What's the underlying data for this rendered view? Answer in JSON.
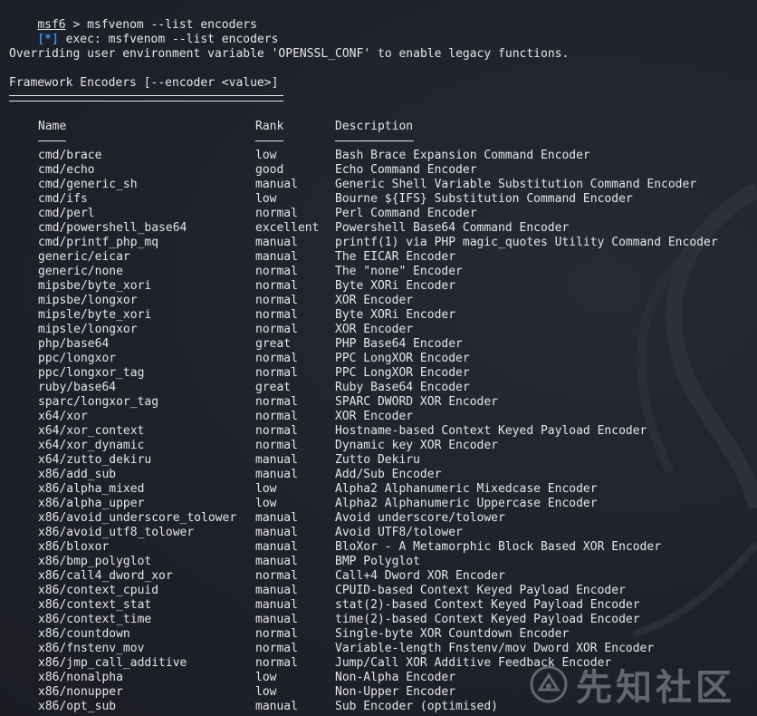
{
  "terminal": {
    "prompt": "msf6",
    "prompt_suffix": " > msfvenom --list encoders",
    "exec_tag": "[*]",
    "exec_text": " exec: msfvenom --list encoders",
    "warning": "Overriding user environment variable 'OPENSSL_CONF' to enable legacy functions.",
    "section_title": "Framework Encoders [--encoder <value>]",
    "columns": {
      "name": "Name",
      "rank": "Rank",
      "description": "Description"
    },
    "watermark_text": "先知社区"
  },
  "encoders": [
    {
      "name": "cmd/brace",
      "rank": "low",
      "description": "Bash Brace Expansion Command Encoder"
    },
    {
      "name": "cmd/echo",
      "rank": "good",
      "description": "Echo Command Encoder"
    },
    {
      "name": "cmd/generic_sh",
      "rank": "manual",
      "description": "Generic Shell Variable Substitution Command Encoder"
    },
    {
      "name": "cmd/ifs",
      "rank": "low",
      "description": "Bourne ${IFS} Substitution Command Encoder"
    },
    {
      "name": "cmd/perl",
      "rank": "normal",
      "description": "Perl Command Encoder"
    },
    {
      "name": "cmd/powershell_base64",
      "rank": "excellent",
      "description": "Powershell Base64 Command Encoder"
    },
    {
      "name": "cmd/printf_php_mq",
      "rank": "manual",
      "description": "printf(1) via PHP magic_quotes Utility Command Encoder"
    },
    {
      "name": "generic/eicar",
      "rank": "manual",
      "description": "The EICAR Encoder"
    },
    {
      "name": "generic/none",
      "rank": "normal",
      "description": "The \"none\" Encoder"
    },
    {
      "name": "mipsbe/byte_xori",
      "rank": "normal",
      "description": "Byte XORi Encoder"
    },
    {
      "name": "mipsbe/longxor",
      "rank": "normal",
      "description": "XOR Encoder"
    },
    {
      "name": "mipsle/byte_xori",
      "rank": "normal",
      "description": "Byte XORi Encoder"
    },
    {
      "name": "mipsle/longxor",
      "rank": "normal",
      "description": "XOR Encoder"
    },
    {
      "name": "php/base64",
      "rank": "great",
      "description": "PHP Base64 Encoder"
    },
    {
      "name": "ppc/longxor",
      "rank": "normal",
      "description": "PPC LongXOR Encoder"
    },
    {
      "name": "ppc/longxor_tag",
      "rank": "normal",
      "description": "PPC LongXOR Encoder"
    },
    {
      "name": "ruby/base64",
      "rank": "great",
      "description": "Ruby Base64 Encoder"
    },
    {
      "name": "sparc/longxor_tag",
      "rank": "normal",
      "description": "SPARC DWORD XOR Encoder"
    },
    {
      "name": "x64/xor",
      "rank": "normal",
      "description": "XOR Encoder"
    },
    {
      "name": "x64/xor_context",
      "rank": "normal",
      "description": "Hostname-based Context Keyed Payload Encoder"
    },
    {
      "name": "x64/xor_dynamic",
      "rank": "normal",
      "description": "Dynamic key XOR Encoder"
    },
    {
      "name": "x64/zutto_dekiru",
      "rank": "manual",
      "description": "Zutto Dekiru"
    },
    {
      "name": "x86/add_sub",
      "rank": "manual",
      "description": "Add/Sub Encoder"
    },
    {
      "name": "x86/alpha_mixed",
      "rank": "low",
      "description": "Alpha2 Alphanumeric Mixedcase Encoder"
    },
    {
      "name": "x86/alpha_upper",
      "rank": "low",
      "description": "Alpha2 Alphanumeric Uppercase Encoder"
    },
    {
      "name": "x86/avoid_underscore_tolower",
      "rank": "manual",
      "description": "Avoid underscore/tolower"
    },
    {
      "name": "x86/avoid_utf8_tolower",
      "rank": "manual",
      "description": "Avoid UTF8/tolower"
    },
    {
      "name": "x86/bloxor",
      "rank": "manual",
      "description": "BloXor - A Metamorphic Block Based XOR Encoder"
    },
    {
      "name": "x86/bmp_polyglot",
      "rank": "manual",
      "description": "BMP Polyglot"
    },
    {
      "name": "x86/call4_dword_xor",
      "rank": "normal",
      "description": "Call+4 Dword XOR Encoder"
    },
    {
      "name": "x86/context_cpuid",
      "rank": "manual",
      "description": "CPUID-based Context Keyed Payload Encoder"
    },
    {
      "name": "x86/context_stat",
      "rank": "manual",
      "description": "stat(2)-based Context Keyed Payload Encoder"
    },
    {
      "name": "x86/context_time",
      "rank": "manual",
      "description": "time(2)-based Context Keyed Payload Encoder"
    },
    {
      "name": "x86/countdown",
      "rank": "normal",
      "description": "Single-byte XOR Countdown Encoder"
    },
    {
      "name": "x86/fnstenv_mov",
      "rank": "normal",
      "description": "Variable-length Fnstenv/mov Dword XOR Encoder"
    },
    {
      "name": "x86/jmp_call_additive",
      "rank": "normal",
      "description": "Jump/Call XOR Additive Feedback Encoder"
    },
    {
      "name": "x86/nonalpha",
      "rank": "low",
      "description": "Non-Alpha Encoder"
    },
    {
      "name": "x86/nonupper",
      "rank": "low",
      "description": "Non-Upper Encoder"
    },
    {
      "name": "x86/opt_sub",
      "rank": "manual",
      "description": "Sub Encoder (optimised)"
    }
  ],
  "colors": {
    "background": "#1e2128",
    "text": "#e6e6e6",
    "info_tag": "#3b8eea"
  },
  "icons": {
    "watermark_logo": "xianzhi-logo-icon"
  }
}
